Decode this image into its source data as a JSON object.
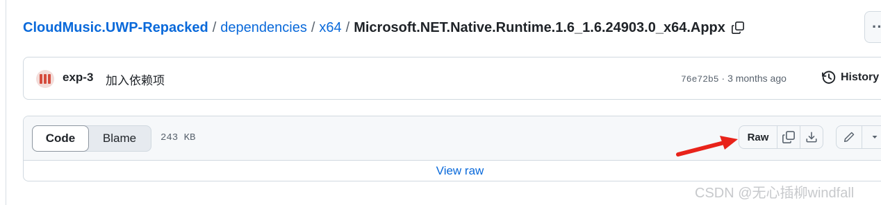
{
  "breadcrumb": {
    "repo": "CloudMusic.UWP-Repacked",
    "sep1": "/",
    "folder1": "dependencies",
    "sep2": "/",
    "folder2": "x64",
    "sep3": "/",
    "file": "Microsoft.NET.Native.Runtime.1.6_1.6.24903.0_x64.Appx",
    "copy_icon": "copy-icon"
  },
  "more_button": {
    "label": "··",
    "icon": "kebab-icon"
  },
  "commit": {
    "author": "exp-3",
    "message": "加入依赖项",
    "sha": "76e72b5",
    "dot": " · ",
    "time": "3 months ago",
    "history_label": "History",
    "history_icon": "history-clock-icon"
  },
  "file_header": {
    "tabs": [
      {
        "label": "Code",
        "selected": true
      },
      {
        "label": "Blame",
        "selected": false
      }
    ],
    "size": "243 KB",
    "raw_label": "Raw",
    "icons": [
      "copy-icon",
      "download-icon",
      "pencil-icon",
      "triangle-down-icon"
    ]
  },
  "file_body": {
    "view_raw_label": "View raw"
  },
  "annotation": {
    "arrow_color": "#e8231a"
  },
  "watermark": "CSDN @无心插柳windfall",
  "colors": {
    "link": "#0969da",
    "text": "#1f2328",
    "muted": "#59636e",
    "border": "#d1d9e0",
    "header_bg": "#f6f8fa"
  }
}
